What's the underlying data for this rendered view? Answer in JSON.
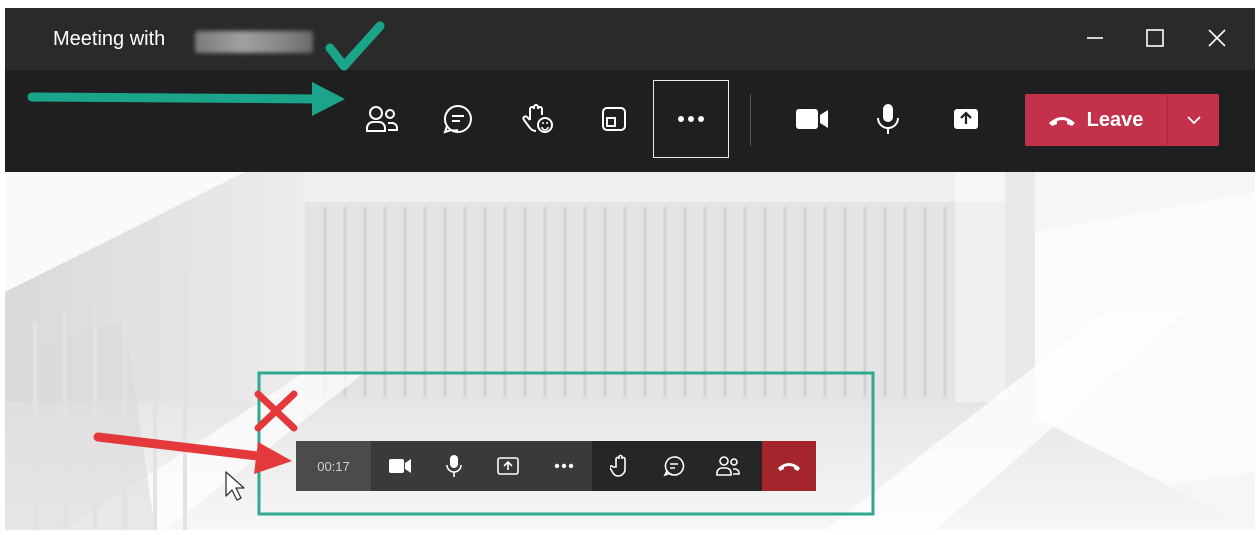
{
  "window": {
    "title": "Meeting with",
    "minimize_icon": "minimize-icon",
    "maximize_icon": "maximize-icon",
    "close_icon": "close-icon"
  },
  "toolbar": {
    "items": [
      {
        "name": "participants",
        "icon": "people-icon"
      },
      {
        "name": "chat",
        "icon": "chat-icon"
      },
      {
        "name": "reactions",
        "icon": "raise-hand-icon"
      },
      {
        "name": "rooms",
        "icon": "rooms-icon"
      },
      {
        "name": "more",
        "icon": "more-icon"
      },
      {
        "name": "camera",
        "icon": "camera-icon"
      },
      {
        "name": "mic",
        "icon": "mic-icon"
      },
      {
        "name": "share",
        "icon": "share-icon"
      }
    ],
    "leave_label": "Leave",
    "leave_color": "#c4314b"
  },
  "mini_toolbar": {
    "timer": "00:17",
    "items": [
      "camera-icon",
      "mic-icon",
      "share-icon",
      "more-icon",
      "raise-hand-icon",
      "chat-icon",
      "people-icon",
      "hang-up-icon"
    ],
    "hangup_color": "#a4262c"
  },
  "annotations": {
    "good_color": "#1aa58a",
    "bad_color": "#e5383b",
    "highlight_color": "#2fa88f"
  }
}
